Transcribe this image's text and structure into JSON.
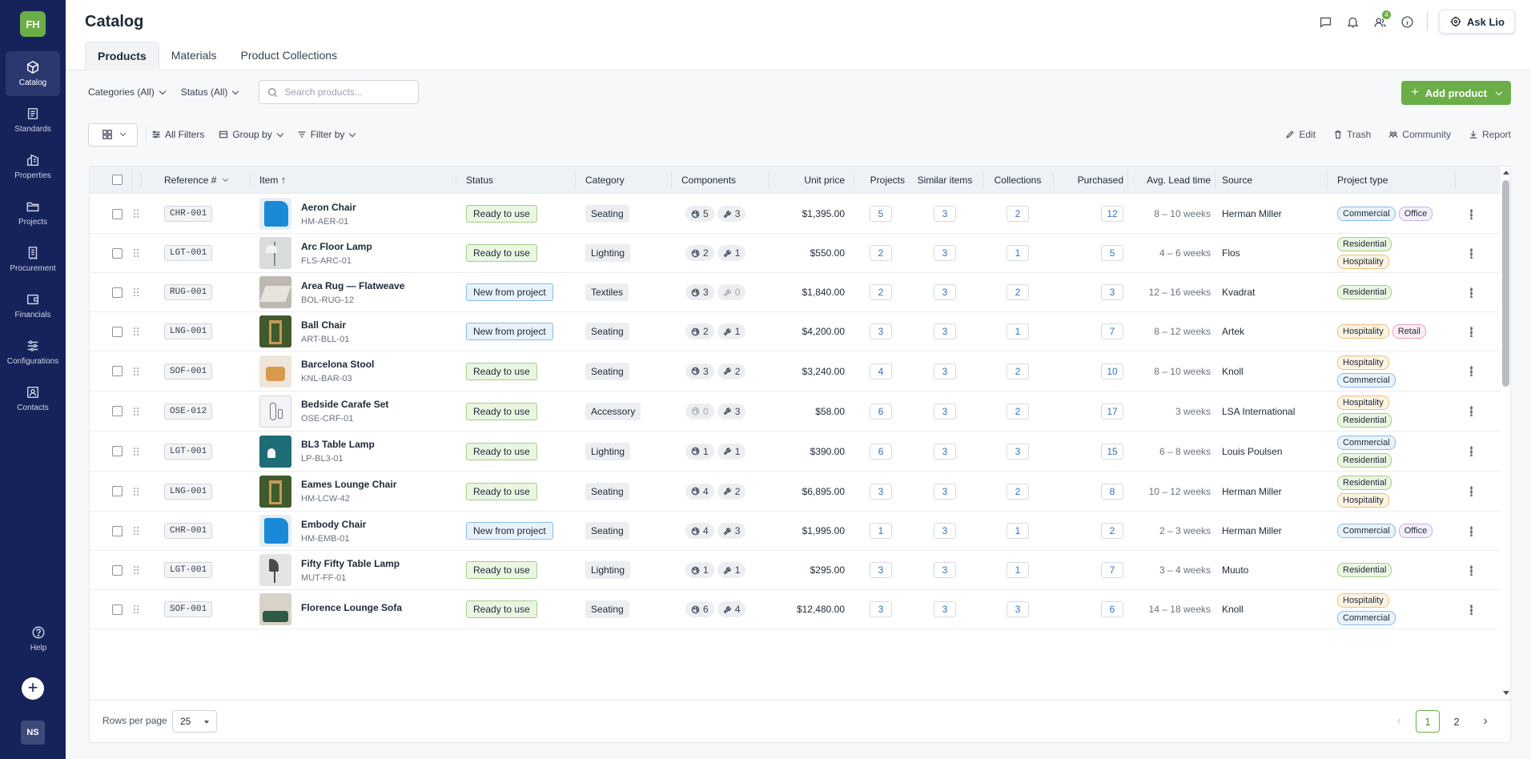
{
  "colors": {
    "sidebar": "#16235a",
    "accent": "#6bae47",
    "link": "#2f73c6"
  },
  "sidebar": {
    "logo": "FH",
    "items": [
      {
        "label": "Catalog",
        "icon": "cube-icon",
        "active": true
      },
      {
        "label": "Standards",
        "icon": "document-icon"
      },
      {
        "label": "Properties",
        "icon": "building-icon"
      },
      {
        "label": "Projects",
        "icon": "folder-icon"
      },
      {
        "label": "Procurement",
        "icon": "receipt-icon"
      },
      {
        "label": "Financials",
        "icon": "wallet-icon"
      },
      {
        "label": "Configurations",
        "icon": "sliders-icon"
      },
      {
        "label": "Contacts",
        "icon": "contact-card-icon"
      }
    ],
    "help": "Help",
    "add": "+",
    "user": "NS"
  },
  "header": {
    "title": "Catalog",
    "tabs": [
      {
        "label": "Products",
        "active": true
      },
      {
        "label": "Materials"
      },
      {
        "label": "Product Collections"
      }
    ],
    "badge": "4",
    "ask": "Ask Lio"
  },
  "filters": {
    "categories": "Categories (All)",
    "status": "Status (All)",
    "search_placeholder": "Search products...",
    "add": "Add product"
  },
  "toolbar": {
    "all_filters": "All Filters",
    "group_by": "Group by",
    "filter_by": "Filter by",
    "edit": "Edit",
    "trash": "Trash",
    "community": "Community",
    "report": "Report"
  },
  "columns": {
    "ref": "Reference #",
    "item": "Item",
    "status": "Status",
    "category": "Category",
    "components": "Components",
    "price": "Unit price",
    "projects": "Projects",
    "similar": "Similar items",
    "collections": "Collections",
    "purchased": "Purchased",
    "lead": "Avg. Lead time",
    "source": "Source",
    "ptype": "Project type"
  },
  "rows": [
    {
      "ref": "CHR-001",
      "name": "Aeron Chair",
      "code": "HM-AER-01",
      "status": "Ready to use",
      "category": "Seating",
      "c1": "5",
      "c2": "3",
      "price": "$1,395.00",
      "projects": "5",
      "similar": "3",
      "collections": "2",
      "purchased": "12",
      "lead": "8 – 10 weeks",
      "source": "Herman Miller",
      "ptypes": [
        "Commercial",
        "Office"
      ],
      "thumb": "blue"
    },
    {
      "ref": "LGT-001",
      "name": "Arc Floor Lamp",
      "code": "FLS-ARC-01",
      "status": "Ready to use",
      "category": "Lighting",
      "c1": "2",
      "c2": "1",
      "price": "$550.00",
      "projects": "2",
      "similar": "3",
      "collections": "1",
      "purchased": "5",
      "lead": "4 – 6 weeks",
      "source": "Flos",
      "ptypes": [
        "Residential",
        "Hospitality"
      ],
      "thumb": "lamp"
    },
    {
      "ref": "RUG-001",
      "name": "Area Rug — Flatweave",
      "code": "BOL-RUG-12",
      "status": "New from project",
      "category": "Textiles",
      "c1": "3",
      "c2": "0",
      "price": "$1,840.00",
      "projects": "2",
      "similar": "3",
      "collections": "2",
      "purchased": "3",
      "lead": "12 – 16 weeks",
      "source": "Kvadrat",
      "ptypes": [
        "Residential"
      ],
      "thumb": "rug"
    },
    {
      "ref": "LNG-001",
      "name": "Ball Chair",
      "code": "ART-BLL-01",
      "status": "New from project",
      "category": "Seating",
      "c1": "2",
      "c2": "1",
      "price": "$4,200.00",
      "projects": "3",
      "similar": "3",
      "collections": "1",
      "purchased": "7",
      "lead": "8 – 12 weeks",
      "source": "Artek",
      "ptypes": [
        "Hospitality",
        "Retail"
      ],
      "thumb": "green"
    },
    {
      "ref": "SOF-001",
      "name": "Barcelona Stool",
      "code": "KNL-BAR-03",
      "status": "Ready to use",
      "category": "Seating",
      "c1": "3",
      "c2": "2",
      "price": "$3,240.00",
      "projects": "4",
      "similar": "3",
      "collections": "2",
      "purchased": "10",
      "lead": "8 – 10 weeks",
      "source": "Knoll",
      "ptypes": [
        "Hospitality",
        "Commercial"
      ],
      "thumb": "stool"
    },
    {
      "ref": "OSE-012",
      "name": "Bedside Carafe Set",
      "code": "OSE-CRF-01",
      "status": "Ready to use",
      "category": "Accessory",
      "c1": "0",
      "c2": "3",
      "price": "$58.00",
      "projects": "6",
      "similar": "3",
      "collections": "2",
      "purchased": "17",
      "lead": "3 weeks",
      "source": "LSA International",
      "ptypes": [
        "Hospitality",
        "Residential"
      ],
      "thumb": "carafe"
    },
    {
      "ref": "LGT-001",
      "name": "BL3 Table Lamp",
      "code": "LP-BL3-01",
      "status": "Ready to use",
      "category": "Lighting",
      "c1": "1",
      "c2": "1",
      "price": "$390.00",
      "projects": "6",
      "similar": "3",
      "collections": "3",
      "purchased": "15",
      "lead": "6 – 8 weeks",
      "source": "Louis Poulsen",
      "ptypes": [
        "Commercial",
        "Residential"
      ],
      "thumb": "teal"
    },
    {
      "ref": "LNG-001",
      "name": "Eames Lounge Chair",
      "code": "HM-LCW-42",
      "status": "Ready to use",
      "category": "Seating",
      "c1": "4",
      "c2": "2",
      "price": "$6,895.00",
      "projects": "3",
      "similar": "3",
      "collections": "2",
      "purchased": "8",
      "lead": "10 – 12 weeks",
      "source": "Herman Miller",
      "ptypes": [
        "Residential",
        "Hospitality"
      ],
      "thumb": "green"
    },
    {
      "ref": "CHR-001",
      "name": "Embody Chair",
      "code": "HM-EMB-01",
      "status": "New from project",
      "category": "Seating",
      "c1": "4",
      "c2": "3",
      "price": "$1,995.00",
      "projects": "1",
      "similar": "3",
      "collections": "1",
      "purchased": "2",
      "lead": "2 – 3 weeks",
      "source": "Herman Miller",
      "ptypes": [
        "Commercial",
        "Office"
      ],
      "thumb": "blue"
    },
    {
      "ref": "LGT-001",
      "name": "Fifty Fifty Table Lamp",
      "code": "MUT-FF-01",
      "status": "Ready to use",
      "category": "Lighting",
      "c1": "1",
      "c2": "1",
      "price": "$295.00",
      "projects": "3",
      "similar": "3",
      "collections": "1",
      "purchased": "7",
      "lead": "3 – 4 weeks",
      "source": "Muuto",
      "ptypes": [
        "Residential"
      ],
      "thumb": "grey"
    },
    {
      "ref": "SOF-001",
      "name": "Florence Lounge Sofa",
      "code": "",
      "status": "Ready to use",
      "category": "Seating",
      "c1": "6",
      "c2": "4",
      "price": "$12,480.00",
      "projects": "3",
      "similar": "3",
      "collections": "3",
      "purchased": "6",
      "lead": "14 – 18 weeks",
      "source": "Knoll",
      "ptypes": [
        "Hospitality",
        "Commercial"
      ],
      "thumb": "sofa"
    }
  ],
  "footer": {
    "rows_per_page_label": "Rows per page",
    "rows_per_page": "25",
    "pages": [
      "1",
      "2"
    ],
    "current_page": "1"
  }
}
